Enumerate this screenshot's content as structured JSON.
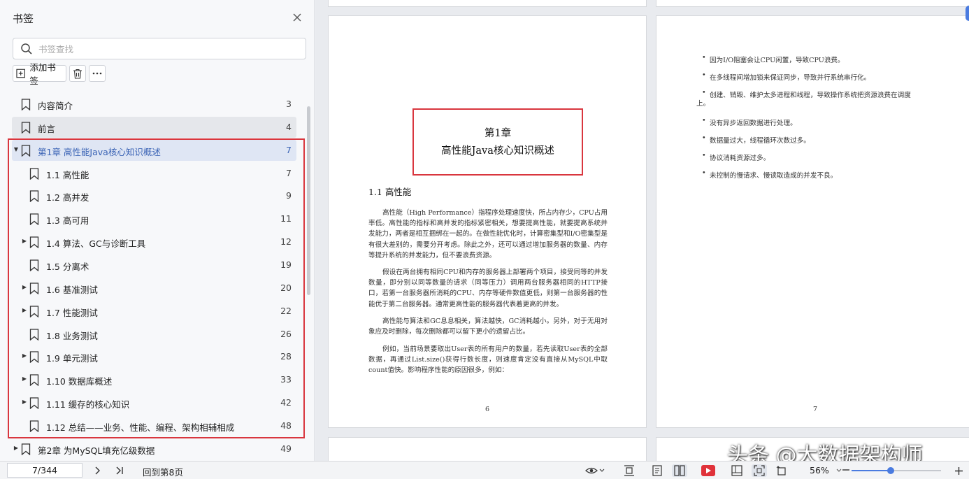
{
  "sidebar": {
    "title": "书签",
    "search_placeholder": "书签查找",
    "add_bookmark_label": "添加书签",
    "icons": {
      "close": "close-icon",
      "search": "search-icon",
      "add": "add-bookmark-icon",
      "delete": "trash-icon",
      "more": "more-icon"
    },
    "items": [
      {
        "label": "内容简介",
        "page": "3",
        "level": 0,
        "expander": "none",
        "state": "normal"
      },
      {
        "label": "前言",
        "page": "4",
        "level": 0,
        "expander": "none",
        "state": "hover"
      },
      {
        "label": "第1章 高性能Java核心知识概述",
        "page": "7",
        "level": 0,
        "expander": "expanded",
        "state": "active"
      },
      {
        "label": "1.1 高性能",
        "page": "7",
        "level": 1,
        "expander": "none",
        "state": "normal"
      },
      {
        "label": "1.2 高并发",
        "page": "9",
        "level": 1,
        "expander": "none",
        "state": "normal"
      },
      {
        "label": "1.3 高可用",
        "page": "11",
        "level": 1,
        "expander": "none",
        "state": "normal"
      },
      {
        "label": "1.4 算法、GC与诊断工具",
        "page": "12",
        "level": 1,
        "expander": "collapsed",
        "state": "normal"
      },
      {
        "label": "1.5 分离术",
        "page": "19",
        "level": 1,
        "expander": "none",
        "state": "normal"
      },
      {
        "label": "1.6 基准测试",
        "page": "20",
        "level": 1,
        "expander": "collapsed",
        "state": "normal"
      },
      {
        "label": "1.7 性能测试",
        "page": "22",
        "level": 1,
        "expander": "collapsed",
        "state": "normal"
      },
      {
        "label": "1.8 业务测试",
        "page": "26",
        "level": 1,
        "expander": "none",
        "state": "normal"
      },
      {
        "label": "1.9 单元测试",
        "page": "28",
        "level": 1,
        "expander": "collapsed",
        "state": "normal"
      },
      {
        "label": "1.10 数据库概述",
        "page": "33",
        "level": 1,
        "expander": "collapsed",
        "state": "normal"
      },
      {
        "label": "1.11 缓存的核心知识",
        "page": "42",
        "level": 1,
        "expander": "collapsed",
        "state": "normal"
      },
      {
        "label": "1.12 总结——业务、性能、编程、架构相辅相成",
        "page": "48",
        "level": 1,
        "expander": "none",
        "state": "normal"
      },
      {
        "label": "第2章 为MySQL填充亿级数据",
        "page": "49",
        "level": 0,
        "expander": "collapsed",
        "state": "normal"
      }
    ]
  },
  "page6": {
    "chapter_line1": "第1章",
    "chapter_line2": "高性能Java核心知识概述",
    "section_title": "1.1   高性能",
    "paragraphs": [
      "高性能（High Performance）指程序处理速度快，所占内存少，CPU占用率低。高性能的指标和高并发的指标紧密相关，想要提高性能，就要提高系统并发能力，两者是相互捆绑在一起的。在做性能优化时，计算密集型和I/O密集型是有很大差别的，需要分开考虑。除此之外，还可以通过增加服务器的数量、内存等提升系统的并发能力，但不要浪费资源。",
      "假设在两台拥有相同CPU和内存的服务器上部署两个项目，接受同等的并发数量，即分别以同等数量的请求（同等压力）调用两台服务器相同的HTTP接口，若第一台服务器所消耗的CPU、内存等硬件数值更低，则第一台服务器的性能优于第二台服务器。通常更高性能的服务器代表着更高的并发。",
      "高性能与算法和GC息息相关，算法越快，GC消耗越小。另外，对于无用对象应及时删除，每次删除都可以留下更小的遗留占比。",
      "例如，当前场景要取出User表的所有用户的数量，若先读取User表的全部数据，再通过List.size()获得行数长度，则速度肯定没有直接从MySQL中取count值快。影响程序性能的原因很多，例如："
    ],
    "page_number": "6"
  },
  "page7": {
    "bullets": [
      "因为I/O阻塞会让CPU闲置，导致CPU浪费。",
      "在多线程间增加锁来保证同步，导致并行系统串行化。",
      "创建、销毁、维护太多进程和线程，导致操作系统把资源浪费在调度",
      "没有异步返回数据进行处理。",
      "数据量过大，线程循环次数过多。",
      "协议消耗资源过多。",
      "未控制的慢请求、慢读取造成的并发不良。"
    ],
    "bullet3_cont": "上。",
    "page_number": "7"
  },
  "watermark": "头条 @大数据架构师",
  "statusbar": {
    "page_indicator": "7/344",
    "back_label": "回到第8页",
    "zoom": "56%",
    "zoom_fraction": 0.44,
    "icons": [
      "next-page-icon",
      "last-page-icon",
      "eye-mode-icon",
      "fit-width-icon",
      "single-page-icon",
      "dual-page-icon",
      "play-icon",
      "thumbnail-icon",
      "fit-page-icon",
      "rotate-icon",
      "zoom-out-icon",
      "zoom-in-icon"
    ]
  },
  "colors": {
    "accent": "#3a63b5",
    "highlight_frame": "#d9363e",
    "play": "#e0323a"
  }
}
